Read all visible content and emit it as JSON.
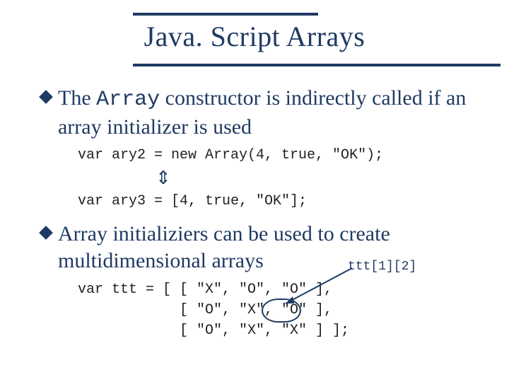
{
  "title": "Java. Script Arrays",
  "bullets": {
    "b1_pre": "The ",
    "b1_code": "Array",
    "b1_post": " constructor is indirectly called if an array initializer is used",
    "b2": "Array initializiers can be used to create multidimensional arrays"
  },
  "code": {
    "ary2": "var ary2 = new Array(4, true, \"OK\");",
    "ary3": "var ary3 = [4, true, \"OK\"];",
    "equiv_glyph": "⇕",
    "ttt_l1": "var ttt = [ [ \"X\", \"O\", \"O\" ],",
    "ttt_l2": "            [ \"O\", \"X\", \"O\" ],",
    "ttt_l3": "            [ \"O\", \"X\", \"X\" ] ];",
    "callout": "ttt[1][2]"
  }
}
